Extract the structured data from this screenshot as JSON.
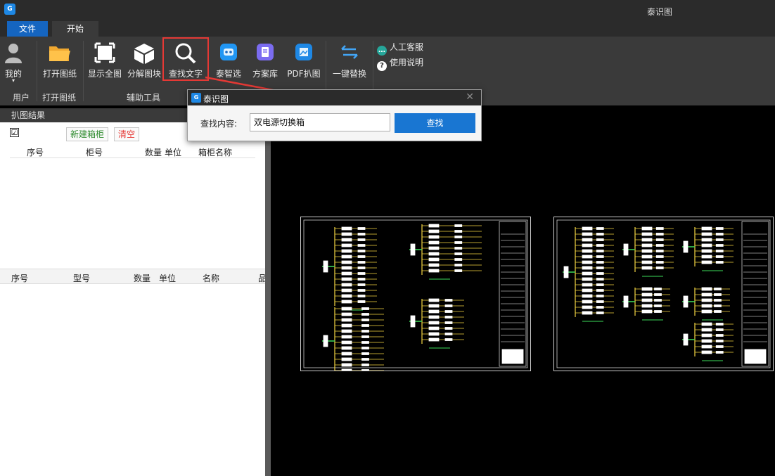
{
  "window": {
    "title": "泰识图",
    "logo_text": "G"
  },
  "menu": {
    "file_label": "文件",
    "start_label": "开始"
  },
  "ribbon": {
    "buttons": {
      "mine": "我的",
      "open_drawing": "打开图纸",
      "show_all": "显示全图",
      "explode_block": "分解图块",
      "find_text": "查找文字",
      "tai_smart": "泰智选",
      "scheme_library": "方案库",
      "pdf_capture": "PDF扒图",
      "one_key_replace": "一键替换",
      "support": "人工客服",
      "help": "使用说明"
    },
    "groups": {
      "user": "用户",
      "open_drawing": "打开图纸",
      "aux_tools": "辅助工具"
    }
  },
  "left_panel": {
    "title": "扒图结果",
    "checkbox_mark": "☑",
    "new_cabinet": "新建箱柜",
    "clear": "清空",
    "top_table_headers": [
      "序号",
      "柜号",
      "数量",
      "单位",
      "箱柜名称"
    ],
    "bottom_table_headers": [
      "序号",
      "型号",
      "数量",
      "单位",
      "名称",
      "品"
    ]
  },
  "dialog": {
    "title": "泰识图",
    "close": "✕",
    "label": "查找内容:",
    "input_value": "双电源切换箱",
    "button": "查找"
  },
  "colors": {
    "accent": "#1976d2",
    "highlight": "#e53935",
    "ribbon_bg": "#3a3a3a",
    "titlebar_bg": "#2b2b2b"
  }
}
